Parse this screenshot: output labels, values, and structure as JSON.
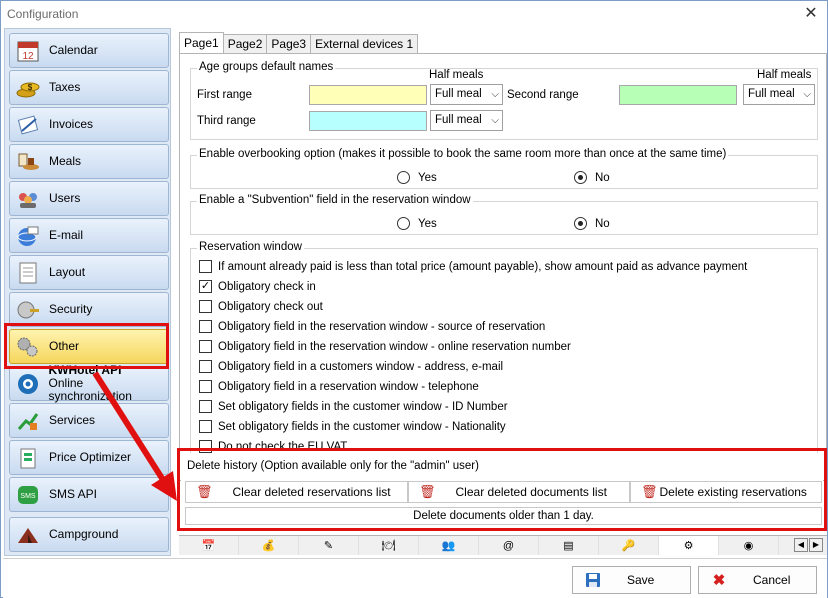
{
  "window": {
    "title": "Configuration",
    "close_glyph": "✕"
  },
  "sidebar": {
    "items": [
      {
        "label": "Calendar",
        "icon": "calendar-icon",
        "glyph": "12"
      },
      {
        "label": "Taxes",
        "icon": "coins-icon",
        "glyph": "$"
      },
      {
        "label": "Invoices",
        "icon": "invoice-icon",
        "glyph": "✎"
      },
      {
        "label": "Meals",
        "icon": "meal-icon",
        "glyph": "🍽"
      },
      {
        "label": "Users",
        "icon": "users-icon",
        "glyph": "👥"
      },
      {
        "label": "E-mail",
        "icon": "email-icon",
        "glyph": "@"
      },
      {
        "label": "Layout",
        "icon": "layout-icon",
        "glyph": "▤"
      },
      {
        "label": "Security",
        "icon": "security-icon",
        "glyph": "🔒"
      },
      {
        "label": "Other",
        "icon": "gears-icon",
        "glyph": "⚙"
      },
      {
        "label": "KWHotel API",
        "sublabel": "Online synchronization",
        "icon": "sync-icon",
        "glyph": "S"
      },
      {
        "label": "Services",
        "icon": "services-icon",
        "glyph": "✚"
      },
      {
        "label": "Price Optimizer",
        "icon": "price-optimizer-icon",
        "glyph": "₵"
      },
      {
        "label": "SMS API",
        "icon": "sms-icon",
        "glyph": "SMS"
      },
      {
        "label": "Campground",
        "icon": "campground-icon",
        "glyph": "⛺"
      }
    ],
    "active_index": 8
  },
  "tabs": [
    "Page1",
    "Page2",
    "Page3",
    "External devices 1"
  ],
  "age_groups": {
    "title": "Age groups default names",
    "half_meals_label": "Half meals",
    "first_range_label": "First range",
    "second_range_label": "Second range",
    "third_range_label": "Third range",
    "first_meal": "Full meal",
    "second_meal": "Full meal",
    "third_meal": "Full meal",
    "first_color": "#ffffb7",
    "second_color": "#b7ffb7",
    "third_color": "#b7ffff"
  },
  "overbooking": {
    "title": "Enable overbooking option (makes it possible to book the same room more than once at the same time)",
    "yes": "Yes",
    "no": "No",
    "selected": "No"
  },
  "subvention": {
    "title": "Enable a \"Subvention\" field in the reservation window",
    "yes": "Yes",
    "no": "No",
    "selected": "No"
  },
  "reservation_window": {
    "title": "Reservation window",
    "options": [
      {
        "label": "If amount already paid is less than total price (amount payable), show amount paid as advance payment",
        "checked": false
      },
      {
        "label": "Obligatory check in",
        "checked": true
      },
      {
        "label": "Obligatory check out",
        "checked": false
      },
      {
        "label": "Obligatory field in the reservation window - source of reservation",
        "checked": false
      },
      {
        "label": "Obligatory field in the reservation window - online reservation number",
        "checked": false
      },
      {
        "label": "Obligatory field in a customers window - address, e-mail",
        "checked": false
      },
      {
        "label": "Obligatory field in a reservation window - telephone",
        "checked": false
      },
      {
        "label": "Set obligatory fields in the customer window - ID Number",
        "checked": false
      },
      {
        "label": "Set obligatory fields in the customer window - Nationality",
        "checked": false
      },
      {
        "label": "Do not check the EU VAT",
        "checked": false
      }
    ]
  },
  "delete_history": {
    "title": "Delete history (Option available only for the \"admin\" user)",
    "clear_reservations": "Clear deleted reservations list",
    "clear_documents": "Clear deleted documents list",
    "delete_existing": "Delete existing reservations",
    "older_than": "Delete documents older than 1 day."
  },
  "footer": {
    "save": "Save",
    "cancel": "Cancel"
  },
  "colors": {
    "highlight": "#e01010",
    "active_item": "#f5d65c",
    "trash": "#c0271f"
  }
}
